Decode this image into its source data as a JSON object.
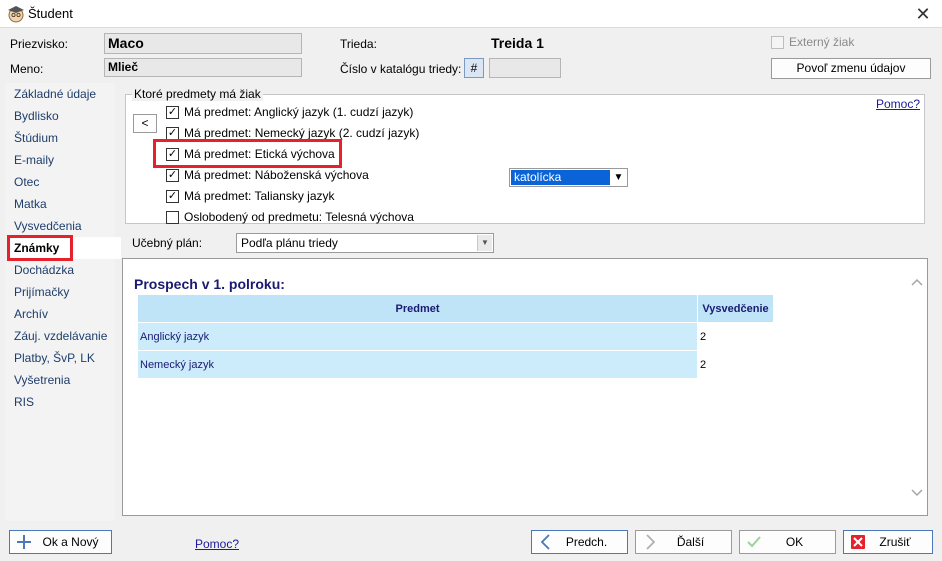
{
  "window": {
    "title": "Študent",
    "close_glyph": "✕",
    "app_icon": "student-avatar-icon"
  },
  "header": {
    "surname_label": "Priezvisko:",
    "surname_value": "Maco",
    "name_label": "Meno:",
    "name_value": "Mlieč",
    "class_label": "Trieda:",
    "class_value": "Treida 1",
    "catalog_label": "Číslo v katalógu triedy:",
    "catalog_hash": "#",
    "catalog_value": "",
    "external_label": "Externý žiak",
    "allow_change_button": "Povoľ zmenu údajov"
  },
  "sidebar": {
    "items": [
      {
        "label": "Základné údaje"
      },
      {
        "label": "Bydlisko"
      },
      {
        "label": "Štúdium"
      },
      {
        "label": "E-maily"
      },
      {
        "label": "Otec"
      },
      {
        "label": "Matka"
      },
      {
        "label": "Vysvedčenia"
      },
      {
        "label": "Známky"
      },
      {
        "label": "Dochádzka"
      },
      {
        "label": "Prijímačky"
      },
      {
        "label": "Archív"
      },
      {
        "label": "Záuj. vzdelávanie"
      },
      {
        "label": "Platby, ŠvP, LK"
      },
      {
        "label": "Vyšetrenia"
      },
      {
        "label": "RIS"
      }
    ],
    "active_index": 7
  },
  "subjects": {
    "legend": "Ktoré predmety má žiak",
    "help_link": "Pomoc?",
    "back_button": "<",
    "items": [
      {
        "label": "Má predmet: Anglický jazyk (1. cudzí jazyk)",
        "checked": true
      },
      {
        "label": "Má predmet: Nemecký jazyk (2. cudzí jazyk)",
        "checked": true
      },
      {
        "label": "Má predmet: Etická výchova",
        "checked": true
      },
      {
        "label": "Má predmet: Náboženská výchova",
        "checked": true
      },
      {
        "label": "Má predmet: Taliansky jazyk",
        "checked": true
      },
      {
        "label": "Oslobodený od predmetu: Telesná výchova",
        "checked": false
      }
    ],
    "religion_select": "katolícka"
  },
  "plan": {
    "label": "Učebný plán:",
    "value": "Podľa plánu triedy"
  },
  "grades": {
    "title": "Prospech v 1. polroku:",
    "columns": [
      "Predmet",
      "Vysvedčenie"
    ],
    "rows": [
      {
        "subject": "Anglický jazyk",
        "grade": "2"
      },
      {
        "subject": "Nemecký jazyk",
        "grade": "2"
      }
    ]
  },
  "footer": {
    "new_button": "Ok a Nový",
    "help_link": "Pomoc?",
    "prev_button": "Predch.",
    "next_button": "Ďalší",
    "ok_button": "OK",
    "cancel_button": "Zrušiť"
  },
  "colors": {
    "highlight": "#e5212b",
    "table_header": "#bfe3f7",
    "table_cell": "#ccecfc",
    "link": "#1a1a9c"
  }
}
